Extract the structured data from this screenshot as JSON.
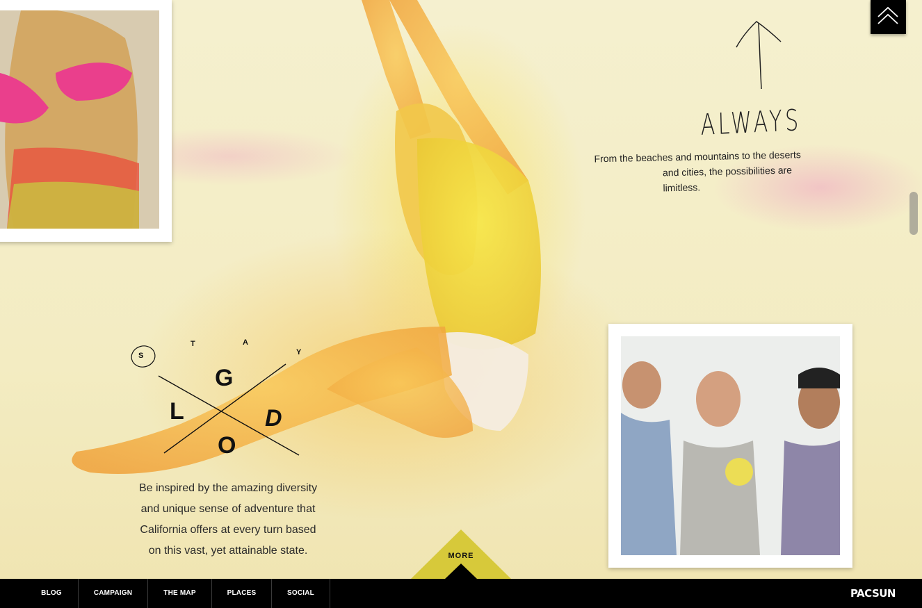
{
  "top_right": {
    "back_to_top_icon": "double-chevron-up-icon"
  },
  "always": {
    "title": "ALWAYS",
    "text_line1": "From the beaches and mountains to the deserts",
    "text_line2": "and cities, the possibilities are limitless."
  },
  "stay_gold": {
    "stay_letters": [
      "S",
      "T",
      "A",
      "Y"
    ],
    "gold_letters": [
      "G",
      "L",
      "D",
      "O"
    ],
    "description_lines": [
      "Be inspired by the amazing diversity",
      "and unique sense of adventure that",
      "California offers at every turn based",
      "on this vast, yet attainable state."
    ]
  },
  "more_tab": {
    "label": "MORE"
  },
  "nav": {
    "items": [
      "BLOG",
      "CAMPAIGN",
      "THE MAP",
      "PLACES",
      "SOCIAL"
    ],
    "brand": "PACSUN"
  },
  "colors": {
    "accent_yellow": "#d7c93a",
    "nav_bg": "#000000",
    "text_dark": "#222222"
  }
}
